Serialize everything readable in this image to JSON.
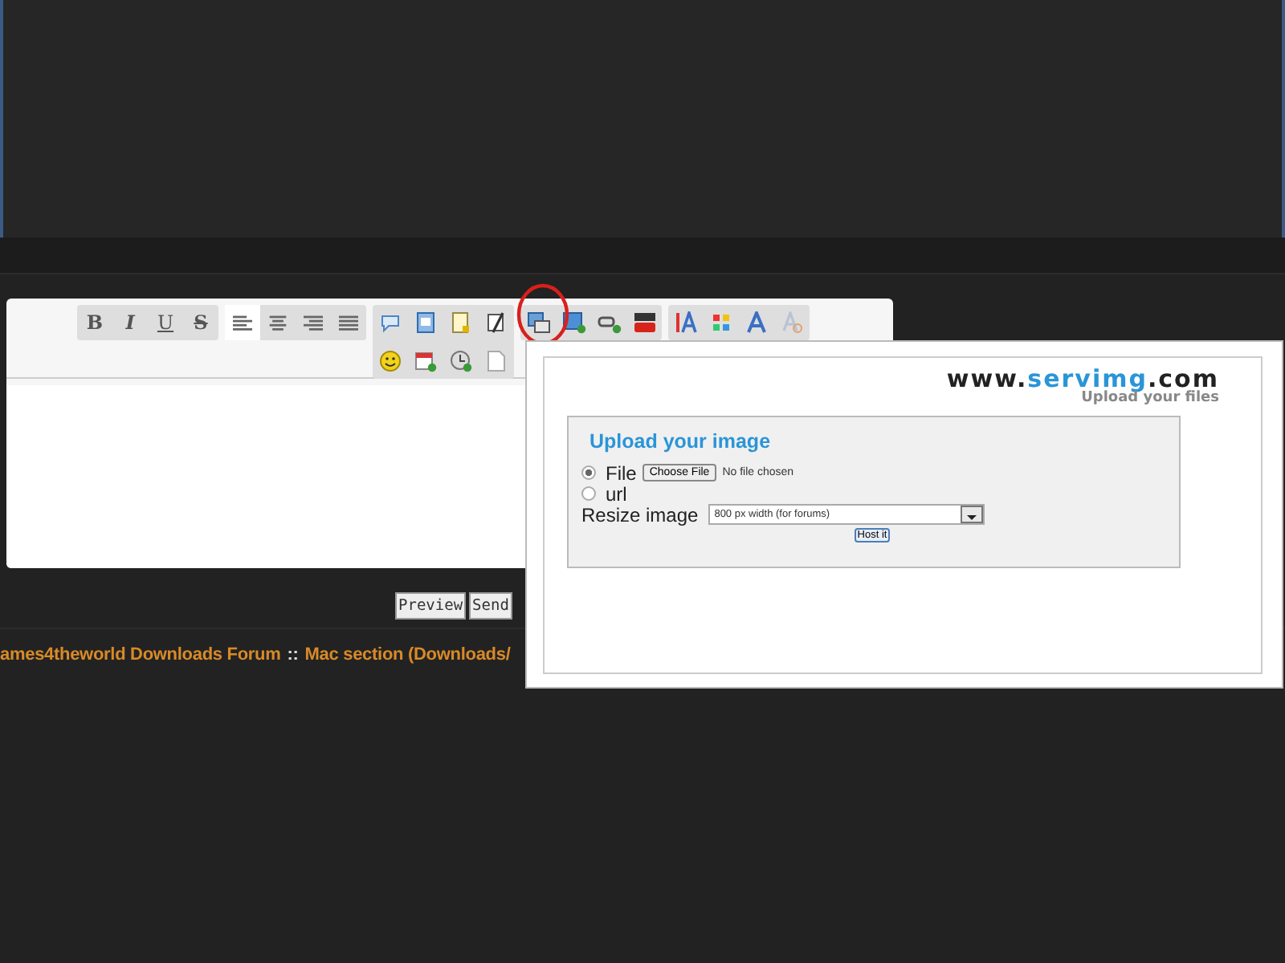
{
  "format_buttons": [
    {
      "label": "B",
      "kind": "bold"
    },
    {
      "label": "I",
      "kind": "italic"
    },
    {
      "label": "U",
      "kind": "underline"
    },
    {
      "label": "S",
      "kind": "strike"
    }
  ],
  "align_buttons": [
    {
      "selected": true
    },
    {
      "selected": false
    },
    {
      "selected": false
    },
    {
      "selected": false
    }
  ],
  "form_buttons": [
    "Preview",
    "Send"
  ],
  "breadcrumb": [
    "ames4theworld Downloads Forum",
    "::",
    "Mac section (Downloads/"
  ],
  "popup": {
    "logo_parts": [
      "www.",
      "servimg",
      ".com"
    ],
    "tagline": "Upload your files",
    "heading": "Upload your image",
    "sources": [
      {
        "label": "File",
        "selected": true
      },
      {
        "label": "url",
        "selected": false
      }
    ],
    "file_button": "Choose File",
    "file_status": "No file chosen",
    "resize_label": "Resize image",
    "resize_value": "800 px width (for forums)",
    "submit": "Host it"
  }
}
